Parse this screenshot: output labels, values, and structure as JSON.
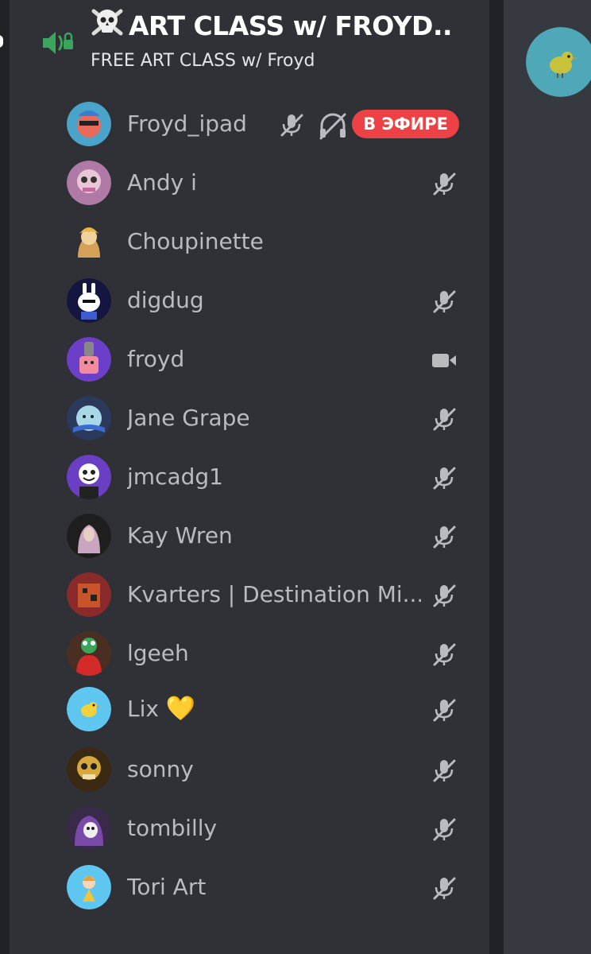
{
  "channel": {
    "title": "ART CLASS w/ FROYD...",
    "subtitle": "FREE ART CLASS w/ Froyd"
  },
  "members": [
    {
      "name": "Froyd_ipad",
      "status": "live",
      "badge": "В ЭФИРЕ",
      "icons": [
        "muted-mic-icon",
        "deafened-icon"
      ],
      "avatar_color": "#4aa3c9"
    },
    {
      "name": "Andy i",
      "status": "muted",
      "avatar_color": "#b07aa6"
    },
    {
      "name": "Choupinette",
      "status": "none",
      "avatar_color": "#d6a25a"
    },
    {
      "name": "digdug",
      "status": "muted",
      "avatar_color": "#1a1f6b"
    },
    {
      "name": "froyd",
      "status": "video",
      "avatar_color": "#6b3fc8"
    },
    {
      "name": "Jane Grape",
      "status": "muted",
      "avatar_color": "#7ab3d6"
    },
    {
      "name": "jmcadg1",
      "status": "muted",
      "avatar_color": "#6a3fc4"
    },
    {
      "name": "Kay Wren",
      "status": "muted",
      "avatar_color": "#3a3a3a"
    },
    {
      "name": "Kvarters | Destination Mi...",
      "status": "muted",
      "avatar_color": "#a52a2a"
    },
    {
      "name": "lgeeh",
      "status": "muted",
      "avatar_color": "#5a3a2a"
    },
    {
      "name": "Lix",
      "emoji": "💛",
      "status": "muted",
      "avatar_color": "#5fc6f0"
    },
    {
      "name": "sonny",
      "status": "muted",
      "avatar_color": "#c89a2a"
    },
    {
      "name": "tombilly",
      "status": "muted",
      "avatar_color": "#5a3a7a"
    },
    {
      "name": "Tori Art",
      "status": "muted",
      "avatar_color": "#5fc6f0"
    }
  ],
  "colors": {
    "panel_bg": "#2f3136",
    "name_text": "#b9bbbe",
    "icon_gray": "#b9bbbe",
    "live_red": "#ed4245",
    "voice_green": "#3ba55d"
  }
}
